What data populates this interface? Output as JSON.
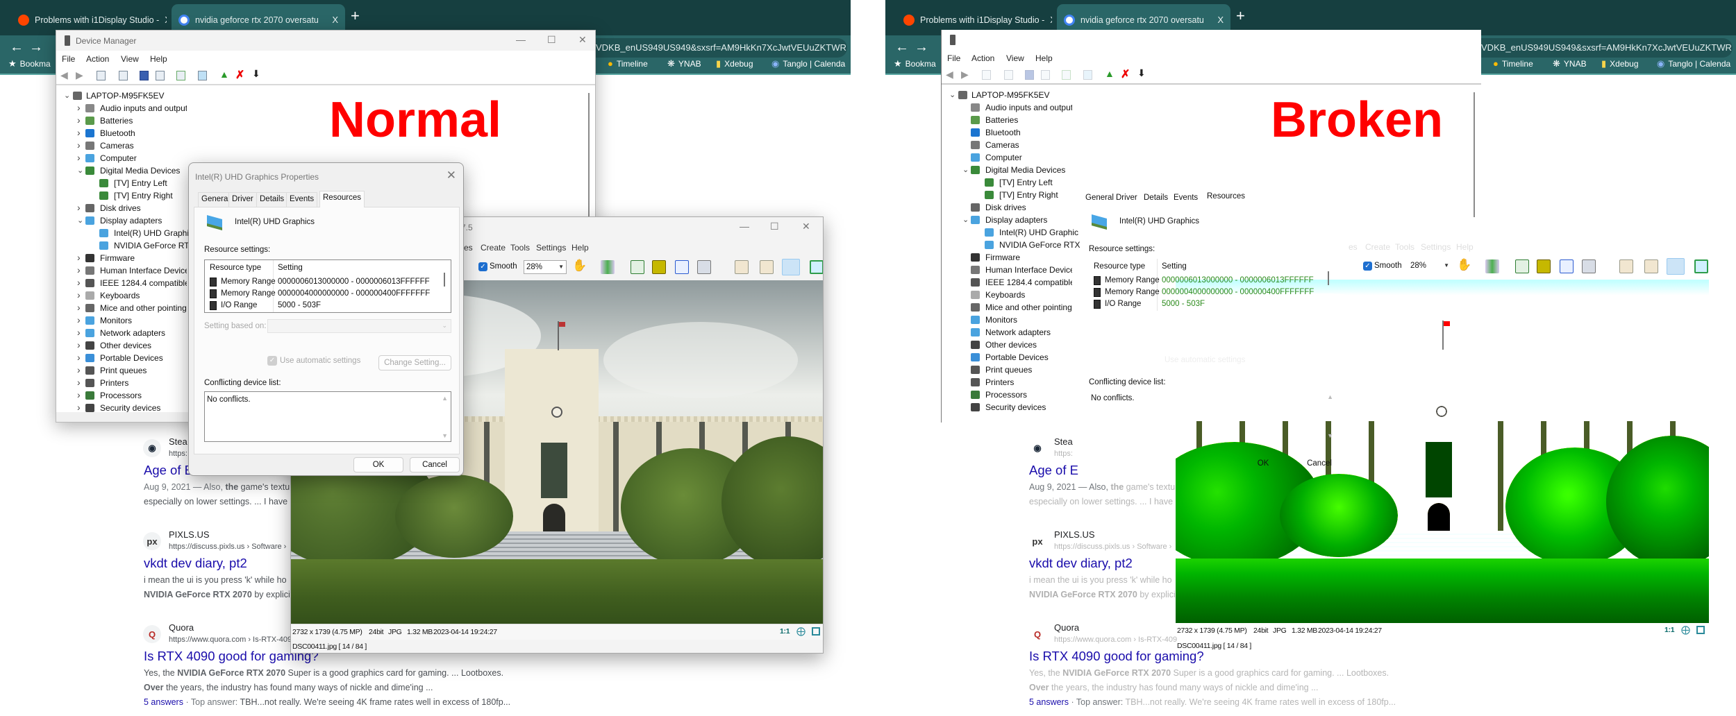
{
  "panels": [
    {
      "label": "Normal"
    },
    {
      "label": "Broken"
    }
  ],
  "browser": {
    "tabs": [
      {
        "title": "Problems with i1Display Studio -",
        "icon": "reddit-icon",
        "close": "X"
      },
      {
        "title": "nvidia geforce rtx 2070 oversatu",
        "icon": "google-icon",
        "close": "X"
      }
    ],
    "new_tab": "+",
    "url_fragment": "VDKB_enUS949US949&sxsrf=AM9HkKn7XcJwtVEUuZKTWR",
    "bookmarks": [
      {
        "label": "Bookma",
        "icon": "star-icon"
      },
      {
        "label": "Timeline",
        "icon": "maps-pin-icon"
      },
      {
        "label": "YNAB",
        "icon": "ynab-icon"
      },
      {
        "label": "Xdebug",
        "icon": "folder-icon"
      },
      {
        "label": "Tanglo | Calenda",
        "icon": "tanglo-icon"
      }
    ]
  },
  "device_manager": {
    "title": "Device Manager",
    "menu": [
      "File",
      "Action",
      "View",
      "Help"
    ],
    "tree": [
      {
        "label": "LAPTOP-M95FK5EV",
        "level": 0,
        "expanded": true,
        "icon": "computer"
      },
      {
        "label": "Audio inputs and outputs",
        "level": 1,
        "expanded": false,
        "icon": "speaker"
      },
      {
        "label": "Batteries",
        "level": 1,
        "expanded": false,
        "icon": "battery"
      },
      {
        "label": "Bluetooth",
        "level": 1,
        "expanded": false,
        "icon": "bluetooth"
      },
      {
        "label": "Cameras",
        "level": 1,
        "expanded": false,
        "icon": "camera"
      },
      {
        "label": "Computer",
        "level": 1,
        "expanded": false,
        "icon": "monitor"
      },
      {
        "label": "Digital Media Devices",
        "level": 1,
        "expanded": true,
        "icon": "media-device"
      },
      {
        "label": "[TV] Entry Left",
        "level": 2,
        "icon": "media-device"
      },
      {
        "label": "[TV] Entry Right",
        "level": 2,
        "icon": "media-device"
      },
      {
        "label": "Disk drives",
        "level": 1,
        "expanded": false,
        "icon": "disk"
      },
      {
        "label": "Display adapters",
        "level": 1,
        "expanded": true,
        "icon": "display-adapter"
      },
      {
        "label": "Intel(R) UHD Graphic",
        "level": 2,
        "icon": "display-adapter"
      },
      {
        "label": "NVIDIA GeForce RTX",
        "level": 2,
        "icon": "display-adapter"
      },
      {
        "label": "Firmware",
        "level": 1,
        "expanded": false,
        "icon": "chip"
      },
      {
        "label": "Human Interface Device",
        "level": 1,
        "expanded": false,
        "icon": "hid"
      },
      {
        "label": "IEEE 1284.4 compatible p",
        "level": 1,
        "expanded": false,
        "icon": "printer"
      },
      {
        "label": "Keyboards",
        "level": 1,
        "expanded": false,
        "icon": "keyboard"
      },
      {
        "label": "Mice and other pointing",
        "level": 1,
        "expanded": false,
        "icon": "mouse"
      },
      {
        "label": "Monitors",
        "level": 1,
        "expanded": false,
        "icon": "monitor"
      },
      {
        "label": "Network adapters",
        "level": 1,
        "expanded": false,
        "icon": "network"
      },
      {
        "label": "Other devices",
        "level": 1,
        "expanded": false,
        "icon": "unknown-device"
      },
      {
        "label": "Portable Devices",
        "level": 1,
        "expanded": false,
        "icon": "portable"
      },
      {
        "label": "Print queues",
        "level": 1,
        "expanded": false,
        "icon": "printer"
      },
      {
        "label": "Printers",
        "level": 1,
        "expanded": false,
        "icon": "printer"
      },
      {
        "label": "Processors",
        "level": 1,
        "expanded": false,
        "icon": "processor"
      },
      {
        "label": "Security devices",
        "level": 1,
        "expanded": false,
        "icon": "security"
      }
    ]
  },
  "properties": {
    "title": "Intel(R) UHD Graphics Properties",
    "tabs": [
      "General",
      "Driver",
      "Details",
      "Events",
      "Resources"
    ],
    "active_tab": "Resources",
    "device_name": "Intel(R) UHD Graphics",
    "resource_settings_label": "Resource settings:",
    "columns": [
      "Resource type",
      "Setting"
    ],
    "rows": [
      {
        "type": "Memory Range",
        "setting": "0000006013000000 - 0000006013FFFFFF"
      },
      {
        "type": "Memory Range",
        "setting": "0000004000000000 - 000000400FFFFFFF"
      },
      {
        "type": "I/O Range",
        "setting": "5000 - 503F"
      }
    ],
    "setting_based_on_label": "Setting based on:",
    "use_automatic_label": "Use automatic settings",
    "use_automatic_checked": true,
    "change_setting": "Change Setting...",
    "conflicting_label": "Conflicting device list:",
    "conflicts": "No conflicts.",
    "ok": "OK",
    "cancel": "Cancel"
  },
  "viewer": {
    "title_fragment": "7.5",
    "menu": [
      "es",
      "Create",
      "Tools",
      "Settings",
      "Help"
    ],
    "smooth_label": "Smooth",
    "smooth_checked": true,
    "zoom": "28%",
    "status": {
      "dimensions": "2732 x 1739 (4.75 MP)",
      "depth": "24bit",
      "format": "JPG",
      "size": "1.32 MB",
      "datetime": "2023-04-14 19:24:27",
      "ratio": "1:1"
    },
    "file": "DSC00411.jpg [ 14 / 84 ]"
  },
  "results": [
    {
      "source": "Stea",
      "icon": "steam-icon",
      "url": "https:",
      "title": "Age of E",
      "lines": [
        [
          {
            "t": "Aug 9, 2021 — Also, ",
            "s": "m"
          },
          {
            "t": "the",
            "s": "b"
          },
          {
            "t": " game's textu",
            "s": ""
          }
        ],
        [
          {
            "t": "especially on lower settings. ... I have",
            "s": ""
          }
        ]
      ]
    },
    {
      "source": "PIXLS.US",
      "icon": "pixls-icon",
      "url": "https://discuss.pixls.us › Software ›",
      "title": "vkdt dev diary, pt2",
      "lines": [
        [
          {
            "t": "i mean the ui is you press 'k' while ho",
            "s": ""
          }
        ],
        [
          {
            "t": "NVIDIA GeForce RTX 2070",
            "s": "b"
          },
          {
            "t": " by explicit",
            "s": ""
          }
        ]
      ]
    },
    {
      "source": "Quora",
      "icon": "quora-icon",
      "url": "https://www.quora.com › Is-RTX-409",
      "title": "Is RTX 4090 good for gaming?",
      "lines": [
        [
          {
            "t": "Yes, the ",
            "s": ""
          },
          {
            "t": "NVIDIA GeForce RTX 2070",
            "s": "b"
          },
          {
            "t": " Super is a good graphics card for gaming. ... Lootboxes.",
            "s": ""
          }
        ],
        [
          {
            "t": "Over",
            "s": "b"
          },
          {
            "t": " the years, the industry has found many ways of nickle and dime'ing ...",
            "s": ""
          }
        ],
        [
          {
            "t": "5 answers",
            "s": "l"
          },
          {
            "t": " · Top answer: ",
            "s": "m"
          },
          {
            "t": "TBH...not really. We're seeing 4K frame rates well in excess of 180fp...",
            "s": ""
          }
        ]
      ]
    }
  ],
  "colors": {
    "label": "#ff0000",
    "browser_tabbar": "#163f40",
    "browser_toolbar": "#2a6667",
    "link": "#1a0dab"
  }
}
